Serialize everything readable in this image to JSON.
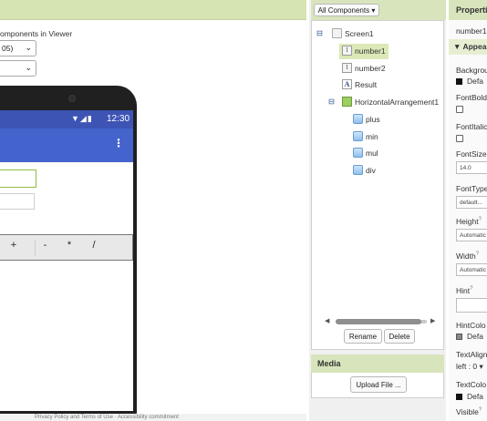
{
  "viewer": {
    "option_label": "omponents in Viewer",
    "screen_size_value": "05)",
    "second_select_value": "",
    "phone": {
      "status_time": "12:30",
      "status_icons": "▼◢▮",
      "menu_glyph": "⋮",
      "buttons": [
        "+",
        "-",
        "*",
        "/"
      ]
    },
    "footer_text": "Privacy Policy and Terms of Use  ·  Accessibility commitment"
  },
  "components": {
    "dropdown_label": "All Components",
    "tree": [
      {
        "label": "Screen1",
        "icon": "screen-icon",
        "expander": "⊟"
      },
      {
        "label": "number1",
        "icon": "textbox-icon",
        "selected": true
      },
      {
        "label": "number2",
        "icon": "textbox-icon"
      },
      {
        "label": "Result",
        "icon": "label-icon"
      },
      {
        "label": "HorizontalArrangement1",
        "icon": "horizontal-arrangement-icon",
        "expander": "⊟"
      },
      {
        "label": "plus",
        "icon": "button-icon"
      },
      {
        "label": "min",
        "icon": "button-icon"
      },
      {
        "label": "mul",
        "icon": "button-icon"
      },
      {
        "label": "div",
        "icon": "button-icon"
      }
    ],
    "rename_label": "Rename",
    "delete_label": "Delete",
    "media_title": "Media",
    "upload_label": "Upload File ..."
  },
  "properties": {
    "title": "Properti",
    "component_name": "number1",
    "group_label": "▼ Appear",
    "background_label": "Backgrou",
    "background_value": "Defa",
    "fontbold_label": "FontBold",
    "fontitalic_label": "FontItalic",
    "fontsize_label": "FontSize",
    "fontsize_value": "14.0",
    "fonttype_label": "FontType",
    "fonttype_value": "default...",
    "height_label": "Height",
    "height_value": "Automatic",
    "width_label": "Width",
    "width_value": "Automatic",
    "hint_label": "Hint",
    "hint_value": "",
    "hintcolor_label": "HintColo",
    "hintcolor_value": "Defa",
    "textalign_label": "TextAlign",
    "textalign_value": "left : 0",
    "textcolor_label": "TextColo",
    "textcolor_value": "Defa",
    "visible_label": "Visible",
    "help_mark": "?"
  },
  "colors": {
    "header_green": "#d8e5bc",
    "selection_green": "#dbe9b6",
    "app_bar_blue": "#4463cc",
    "status_bar_blue": "#3d54b5"
  }
}
